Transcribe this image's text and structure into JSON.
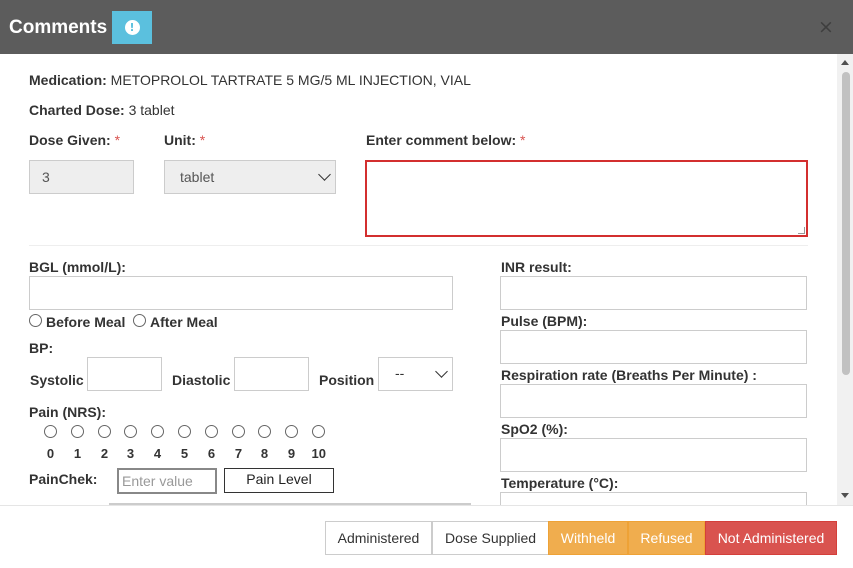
{
  "header": {
    "title": "Comments",
    "info_icon": "info-icon",
    "close_label": "×"
  },
  "medication": {
    "label": "Medication:",
    "value": "METOPROLOL TARTRATE 5 MG/5 ML INJECTION, VIAL"
  },
  "charted_dose": {
    "label": "Charted Dose:",
    "value": "3 tablet"
  },
  "dose_given": {
    "label": "Dose Given:",
    "required": "*",
    "value": "3"
  },
  "unit": {
    "label": "Unit:",
    "required": "*",
    "value": "tablet"
  },
  "comment": {
    "label": "Enter comment below:",
    "required": "*",
    "value": ""
  },
  "bgl": {
    "label": "BGL (mmol/L):",
    "value": "",
    "before_meal": "Before Meal",
    "after_meal": "After Meal"
  },
  "bp": {
    "label": "BP:",
    "systolic": "Systolic",
    "diastolic": "Diastolic",
    "position": "Position",
    "position_value": "--"
  },
  "pain": {
    "label": "Pain (NRS):",
    "scale": [
      "0",
      "1",
      "2",
      "3",
      "4",
      "5",
      "6",
      "7",
      "8",
      "9",
      "10"
    ]
  },
  "painchek": {
    "label": "PainChek:",
    "placeholder": "Enter value",
    "button": "Pain Level"
  },
  "right_fields": {
    "inr": "INR result:",
    "pulse": "Pulse (BPM):",
    "respiration": "Respiration rate (Breaths Per Minute) :",
    "spo2": "SpO2 (%):",
    "temperature": "Temperature (°C):"
  },
  "footer": {
    "administered": "Administered",
    "dose_supplied": "Dose Supplied",
    "withheld": "Withheld",
    "refused": "Refused",
    "not_administered": "Not Administered"
  },
  "colors": {
    "header": "#5c5c5c",
    "info": "#5bc0de",
    "warning": "#f0ad4e",
    "danger": "#d9534f",
    "required": "#d9534f"
  }
}
